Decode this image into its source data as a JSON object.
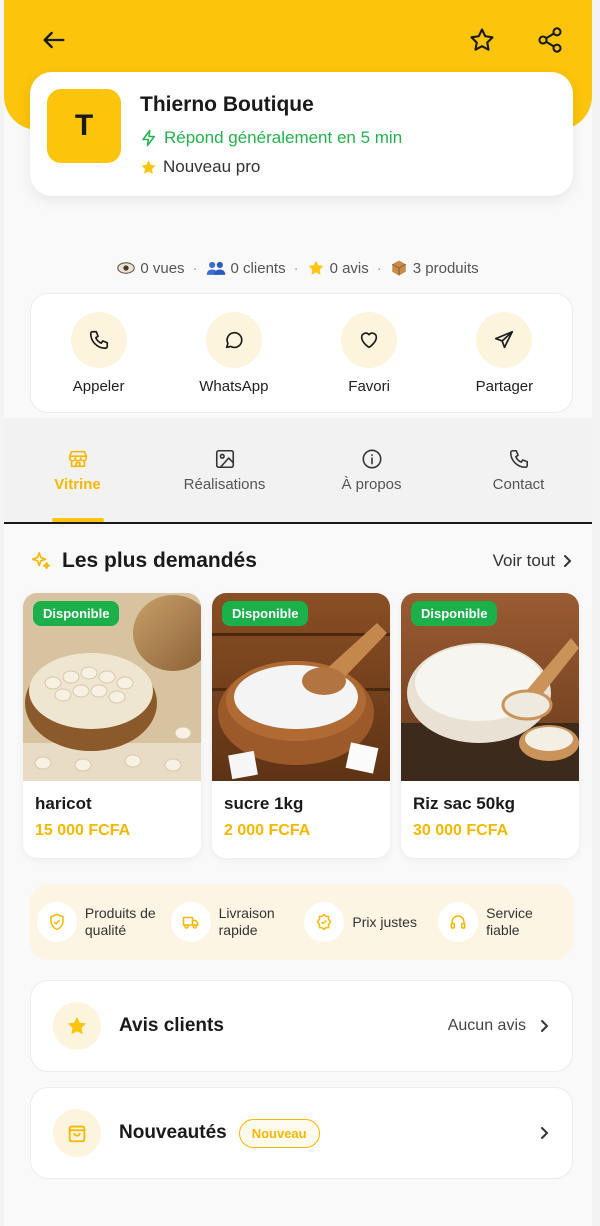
{
  "colors": {
    "brand": "#fcc40a",
    "accent": "#f5b800",
    "success": "#1bb04a",
    "response_green": "#22b34c"
  },
  "header": {
    "back_icon": "arrow-left-icon",
    "favorite_icon": "star-outline-icon",
    "share_icon": "share-icon"
  },
  "shop": {
    "avatar_letter": "T",
    "name": "Thierno Boutique",
    "response_time": "Répond généralement en 5 min",
    "badge": "Nouveau pro"
  },
  "stats": {
    "views": "0 vues",
    "clients": "0 clients",
    "reviews": "0 avis",
    "products": "3 produits",
    "separator": "·"
  },
  "actions": [
    {
      "label": "Appeler",
      "icon": "phone-icon"
    },
    {
      "label": "WhatsApp",
      "icon": "chat-icon"
    },
    {
      "label": "Favori",
      "icon": "heart-icon"
    },
    {
      "label": "Partager",
      "icon": "send-icon"
    }
  ],
  "tabs": [
    {
      "label": "Vitrine",
      "icon": "store-icon",
      "active": true
    },
    {
      "label": "Réalisations",
      "icon": "image-icon",
      "active": false
    },
    {
      "label": "À propos",
      "icon": "info-icon",
      "active": false
    },
    {
      "label": "Contact",
      "icon": "phone-icon",
      "active": false
    }
  ],
  "popular": {
    "title": "Les plus demandés",
    "see_all": "Voir tout",
    "products": [
      {
        "status": "Disponible",
        "name": "haricot",
        "price": "15 000 FCFA"
      },
      {
        "status": "Disponible",
        "name": "sucre 1kg",
        "price": "2 000 FCFA"
      },
      {
        "status": "Disponible",
        "name": "Riz sac 50kg",
        "price": "30 000 FCFA"
      }
    ]
  },
  "features": [
    {
      "label": "Produits de qualité",
      "icon": "shield-icon"
    },
    {
      "label": "Livraison rapide",
      "icon": "truck-icon"
    },
    {
      "label": "Prix justes",
      "icon": "badge-icon"
    },
    {
      "label": "Service fiable",
      "icon": "headphones-icon"
    }
  ],
  "reviews_row": {
    "title": "Avis clients",
    "status": "Aucun avis"
  },
  "news_row": {
    "title": "Nouveautés",
    "badge": "Nouveau"
  }
}
